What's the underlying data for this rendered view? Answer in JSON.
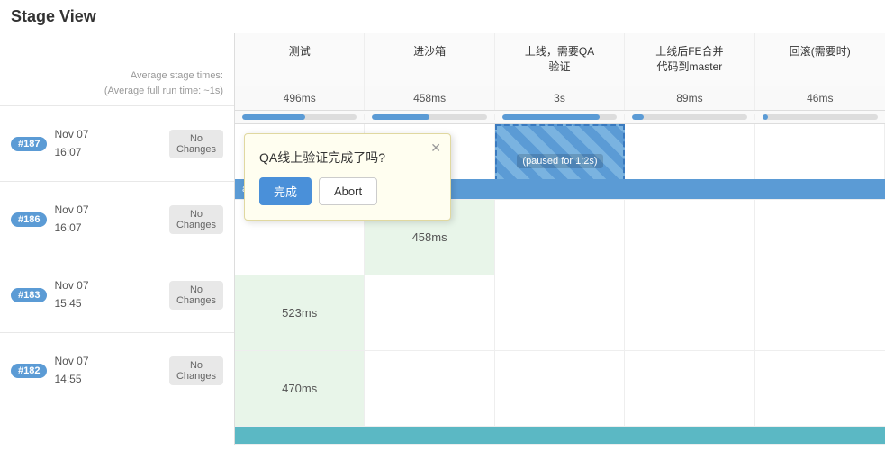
{
  "title": "Stage View",
  "sidebar": {
    "avg_label": "Average stage times:",
    "avg_full": "(Average full run time: ~1s)",
    "builds": [
      {
        "id": "#187",
        "date": "Nov 07",
        "time": "16:07",
        "no_changes": "No\nChanges"
      },
      {
        "id": "#186",
        "date": "Nov 07",
        "time": "16:07",
        "no_changes": "No\nChanges"
      },
      {
        "id": "#183",
        "date": "Nov 07",
        "time": "15:45",
        "no_changes": "No\nChanges"
      },
      {
        "id": "#182",
        "date": "Nov 07",
        "time": "14:55",
        "no_changes": "No\nChanges"
      }
    ]
  },
  "columns": [
    {
      "header": "测试",
      "avg": "496ms",
      "progress": 55
    },
    {
      "header": "进沙箱",
      "avg": "458ms",
      "progress": 50
    },
    {
      "header": "上线，需要QA\n验证",
      "avg": "3s",
      "progress": 85
    },
    {
      "header": "上线后FE合并\n代码到master",
      "avg": "89ms",
      "progress": 10
    },
    {
      "header": "回滚(需要时)",
      "avg": "46ms",
      "progress": 5
    }
  ],
  "popup": {
    "title": "QA线上验证完成了吗?",
    "complete_label": "完成",
    "abort_label": "Abort",
    "paused_label": "(paused for 1:2s)"
  },
  "almost_complete": "almost complete",
  "rows": [
    {
      "cells": [
        "",
        "",
        "paused",
        "",
        ""
      ]
    },
    {
      "cells": [
        "",
        "458ms",
        "",
        "",
        ""
      ]
    },
    {
      "cells": [
        "523ms",
        "",
        "",
        "",
        ""
      ]
    },
    {
      "cells": [
        "470ms",
        "",
        "",
        "",
        ""
      ]
    }
  ]
}
